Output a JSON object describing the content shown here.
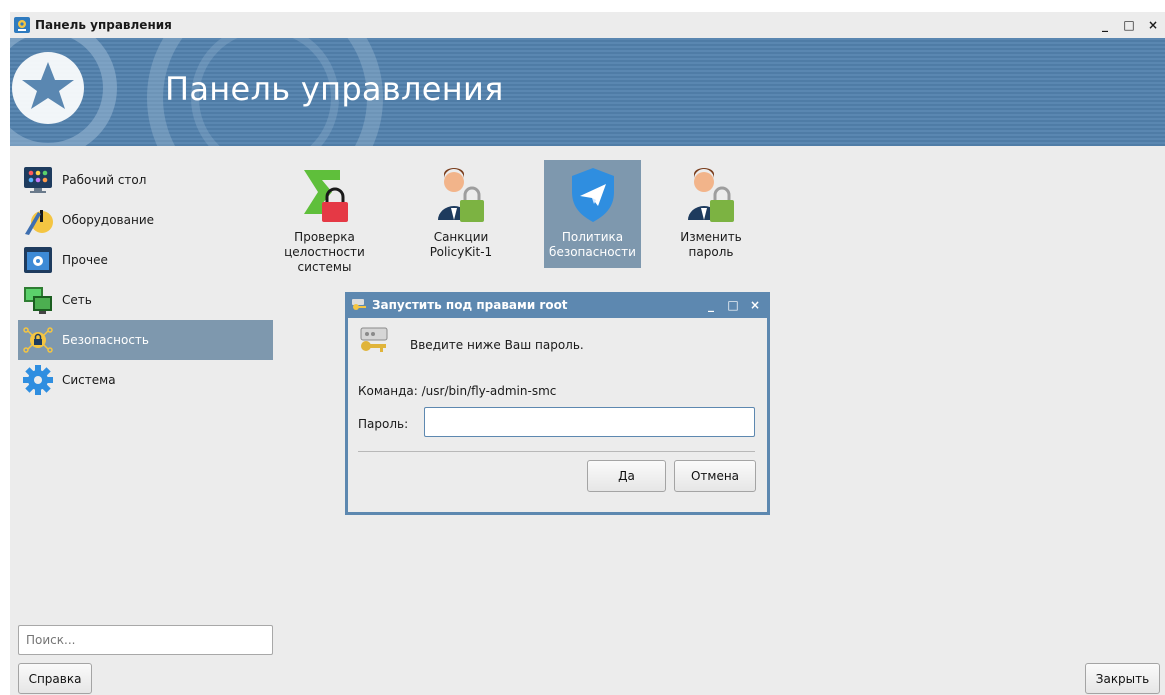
{
  "window": {
    "title": "Панель управления",
    "minimize": "_",
    "maximize": "□",
    "close": "×"
  },
  "banner": {
    "title": "Панель управления"
  },
  "sidebar": {
    "items": [
      {
        "label": "Рабочий стол",
        "icon": "desktop-icon"
      },
      {
        "label": "Оборудование",
        "icon": "hardware-icon"
      },
      {
        "label": "Прочее",
        "icon": "other-icon"
      },
      {
        "label": "Сеть",
        "icon": "network-icon"
      },
      {
        "label": "Безопасность",
        "icon": "security-icon",
        "selected": true
      },
      {
        "label": "Система",
        "icon": "system-gear-icon"
      }
    ]
  },
  "search": {
    "placeholder": "Поиск..."
  },
  "tiles": [
    {
      "label_lines": [
        "Проверка",
        "целостности",
        "системы"
      ],
      "icon": "sigma-lock-icon"
    },
    {
      "label_lines": [
        "Санкции PolicyKit-1"
      ],
      "icon": "user-lock-icon"
    },
    {
      "label_lines": [
        "Политика",
        "безопасности"
      ],
      "icon": "shield-plane-icon",
      "selected": true
    },
    {
      "label_lines": [
        "Изменить пароль"
      ],
      "icon": "user-lock-icon"
    }
  ],
  "dialog": {
    "title": "Запустить под правами root",
    "minimize": "_",
    "maximize": "□",
    "close": "×",
    "prompt": "Введите ниже Ваш пароль.",
    "command_label": "Команда:",
    "command_value": "/usr/bin/fly-admin-smc",
    "password_label": "Пароль:",
    "password_value": "",
    "ok_label": "Да",
    "cancel_label": "Отмена"
  },
  "footer": {
    "help_label": "Справка",
    "close_label": "Закрыть"
  },
  "colors": {
    "banner": "#5a87b1",
    "selection": "#7e98ae",
    "dialog_frame": "#5d88b0"
  }
}
